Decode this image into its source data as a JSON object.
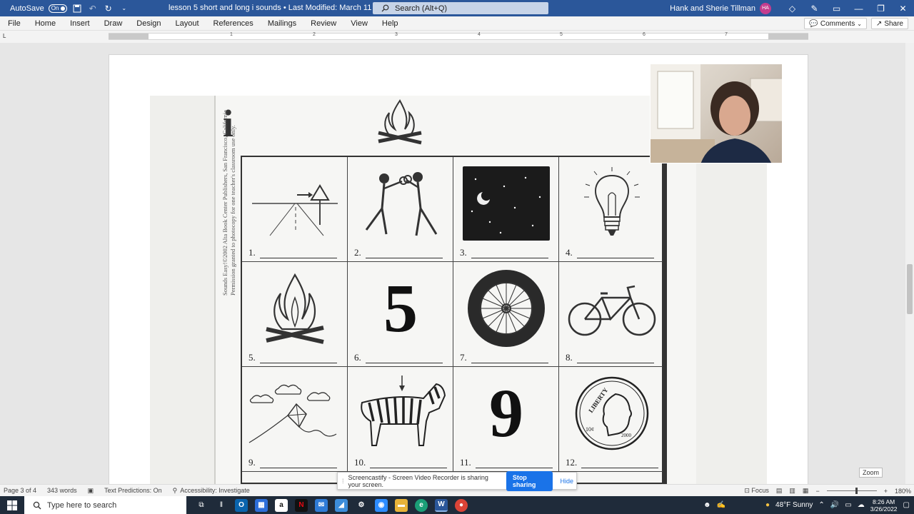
{
  "titlebar": {
    "autosave_label": "AutoSave",
    "autosave_state": "On",
    "doc_title": "lesson 5 short and long i sounds • Last Modified: March 11",
    "search_placeholder": "Search (Alt+Q)",
    "user_name": "Hank and Sherie Tillman",
    "user_initials": "HA"
  },
  "menu": {
    "items": [
      "File",
      "Home",
      "Insert",
      "Draw",
      "Design",
      "Layout",
      "References",
      "Mailings",
      "Review",
      "View",
      "Help"
    ],
    "comments_label": "Comments",
    "share_label": "Share"
  },
  "ruler": {
    "tab_selector": "L",
    "numbers": [
      "1",
      "2",
      "3",
      "4",
      "5",
      "6",
      "7"
    ]
  },
  "worksheet": {
    "heading_letter": "i",
    "copyright_lines": [
      "Sounds Easy!©2002 Alta Book Center Publishers, San Francisco, California",
      "Permission granted to photocopy for one teacher's classroom use only."
    ],
    "cells": [
      {
        "label": "1.",
        "picture": "road-sign"
      },
      {
        "label": "2.",
        "picture": "boxers"
      },
      {
        "label": "3.",
        "picture": "night-sky"
      },
      {
        "label": "4.",
        "picture": "light-bulb"
      },
      {
        "label": "5.",
        "picture": "campfire"
      },
      {
        "label": "6.",
        "picture": "numeral",
        "numeral": "5"
      },
      {
        "label": "7.",
        "picture": "tire"
      },
      {
        "label": "8.",
        "picture": "bicycle"
      },
      {
        "label": "9.",
        "picture": "kite"
      },
      {
        "label": "10.",
        "picture": "zebra"
      },
      {
        "label": "11.",
        "picture": "numeral",
        "numeral": "9"
      },
      {
        "label": "12.",
        "picture": "dime",
        "coin_text": "LIBERTY",
        "coin_value": "10¢",
        "coin_year": "2000"
      }
    ]
  },
  "status": {
    "page": "Page 3 of 4",
    "words": "343 words",
    "text_predictions": "Text Predictions: On",
    "accessibility": "Accessibility: Investigate",
    "focus": "Focus",
    "zoom_level": "180%",
    "zoom_tooltip": "Zoom"
  },
  "sharebar": {
    "message": "Screencastify - Screen Video Recorder is sharing your screen.",
    "stop_label": "Stop sharing",
    "hide_label": "Hide"
  },
  "taskbar": {
    "search_placeholder": "Type here to search",
    "weather": "48°F  Sunny",
    "time": "8:26 AM",
    "date": "3/26/2022"
  },
  "colors": {
    "word_blue": "#2b579a",
    "share_blue": "#1a73e8"
  }
}
